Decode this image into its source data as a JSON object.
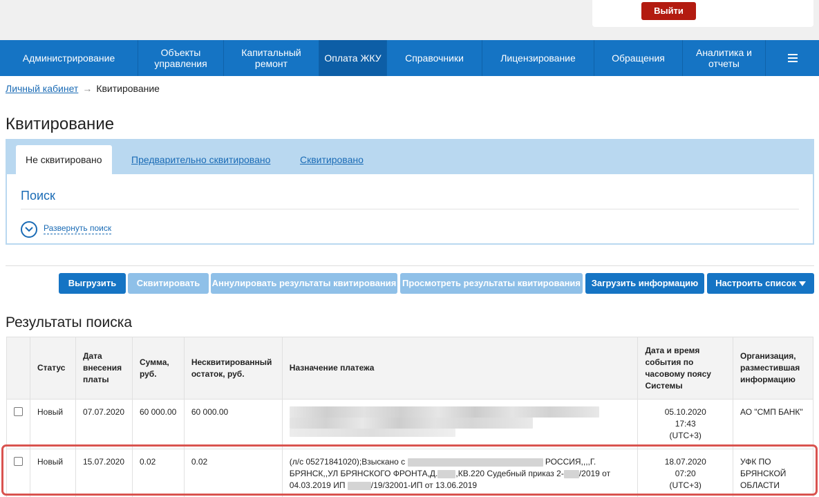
{
  "header": {
    "logout_label": "Выйти"
  },
  "nav": {
    "items": [
      {
        "label": "Администрирование"
      },
      {
        "label": "Объекты управления"
      },
      {
        "label": "Капитальный ремонт"
      },
      {
        "label": "Оплата ЖКУ"
      },
      {
        "label": "Справочники"
      },
      {
        "label": "Лицензирование"
      },
      {
        "label": "Обращения"
      },
      {
        "label": "Аналитика и отчеты"
      }
    ],
    "active": "Оплата ЖКУ",
    "menu_icon": "hamburger-menu-icon"
  },
  "breadcrumb": {
    "home": "Личный кабинет",
    "separator": "→",
    "current": "Квитирование"
  },
  "page": {
    "title": "Квитирование"
  },
  "tabs": [
    {
      "label": "Не сквитировано"
    },
    {
      "label": "Предварительно сквитировано"
    },
    {
      "label": "Сквитировано"
    }
  ],
  "search": {
    "title": "Поиск",
    "expand_label": "Развернуть поиск",
    "expand_icon": "chevron-down-circle-icon"
  },
  "toolbar": {
    "export": "Выгрузить",
    "reconcile": "Сквитировать",
    "cancel_results": "Аннулировать результаты квитирования",
    "view_results": "Просмотреть результаты квитирования",
    "upload_info": "Загрузить информацию",
    "configure_list": "Настроить список"
  },
  "results": {
    "title": "Результаты поиска",
    "columns": {
      "status": "Статус",
      "payment_date": "Дата внесения платы",
      "amount": "Сумма, руб.",
      "unreconciled": "Несквитированный остаток, руб.",
      "purpose": "Назначение платежа",
      "event_datetime": "Дата и время события по часовому поясу Системы",
      "organization": "Организация, разместившая информацию"
    },
    "rows": [
      {
        "status": "Новый",
        "payment_date": "07.07.2020",
        "amount": "60 000.00",
        "unreconciled": "60 000.00",
        "purpose_line1": "",
        "purpose_line2": "",
        "purpose_line3": "",
        "event_date": "05.10.2020",
        "event_time": "17:43",
        "event_tz": "(UTC+3)",
        "organization": "АО \"СМП БАНК\""
      },
      {
        "status": "Новый",
        "payment_date": "15.07.2020",
        "amount": "0.02",
        "unreconciled": "0.02",
        "purpose_p1": "(л/с 05271841020);Взыскано с",
        "purpose_p2": "РОССИЯ,,,,Г.",
        "purpose_p3": "БРЯНСК,,УЛ БРЯНСКОГО ФРОНТА,Д.",
        "purpose_p4": ",КВ.220 Судебный приказ 2-",
        "purpose_p5": "/2019 от",
        "purpose_p6": "04.03.2019 ИП",
        "purpose_p7": "/19/32001-ИП от 13.06.2019",
        "event_date": "18.07.2020",
        "event_time": "07:20",
        "event_tz": "(UTC+3)",
        "organization": "УФК ПО БРЯНСКОЙ ОБЛАСТИ"
      }
    ]
  },
  "colors": {
    "nav_bg": "#1574c4",
    "logout_bg": "#b31b10",
    "highlight": "#d9534f",
    "tabs_bg": "#b9d8f0"
  }
}
